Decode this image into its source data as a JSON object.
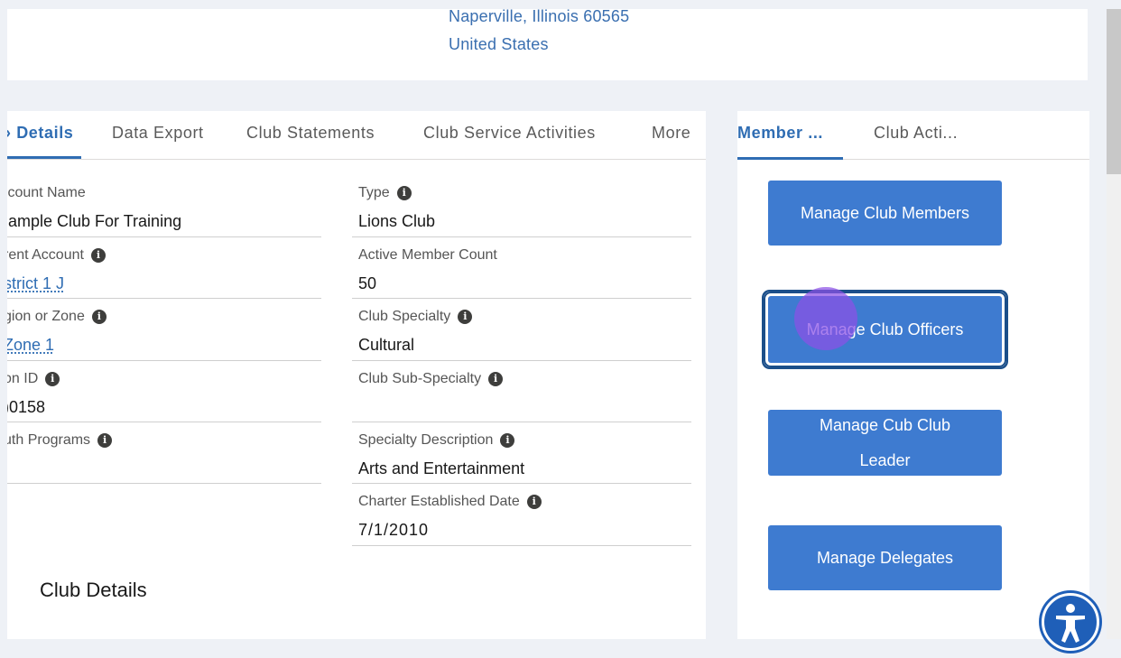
{
  "address": {
    "line1": "Naperville, Illinois 60565",
    "line2": "United States"
  },
  "main_tabs": [
    {
      "label": "› Details"
    },
    {
      "label": "Data Export"
    },
    {
      "label": "Club Statements"
    },
    {
      "label": "Club Service Activities"
    },
    {
      "label": "More"
    }
  ],
  "fields": {
    "account_name": {
      "label": ":count Name",
      "value": ":ample Club For Training"
    },
    "type": {
      "label": "Type",
      "value": "Lions Club"
    },
    "parent_account": {
      "label": "rent Account",
      "value": "strict 1 J"
    },
    "active_member_count": {
      "label": "Active Member Count",
      "value": "50"
    },
    "region_zone": {
      "label": "gion or Zone",
      "value": "Zone 1"
    },
    "club_specialty": {
      "label": "Club Specialty",
      "value": "Cultural"
    },
    "lion_id": {
      "label": "on ID",
      "value": ")0158"
    },
    "club_sub_specialty": {
      "label": "Club Sub-Specialty",
      "value": ""
    },
    "youth_programs": {
      "label": "uth Programs",
      "value": ""
    },
    "specialty_description": {
      "label": "Specialty Description",
      "value": "Arts and Entertainment"
    },
    "charter_date": {
      "label": "Charter Established Date",
      "value": "7/1/2010"
    }
  },
  "section": {
    "heading": "Club Details"
  },
  "side_tabs": [
    {
      "label": "Member ..."
    },
    {
      "label": "Club Acti..."
    }
  ],
  "actions": {
    "manage_members": "Manage Club Members",
    "manage_officers": "Manage Club Officers",
    "manage_cub_leader_line1": "Manage Cub Club",
    "manage_cub_leader_line2": "Leader",
    "manage_delegates": "Manage Delegates"
  },
  "icons": {
    "info": "info-icon",
    "accessibility": "accessibility-icon"
  },
  "colors": {
    "link": "#2f6db3",
    "button": "#3e7bd0",
    "click_marker": "#8c50e6"
  }
}
